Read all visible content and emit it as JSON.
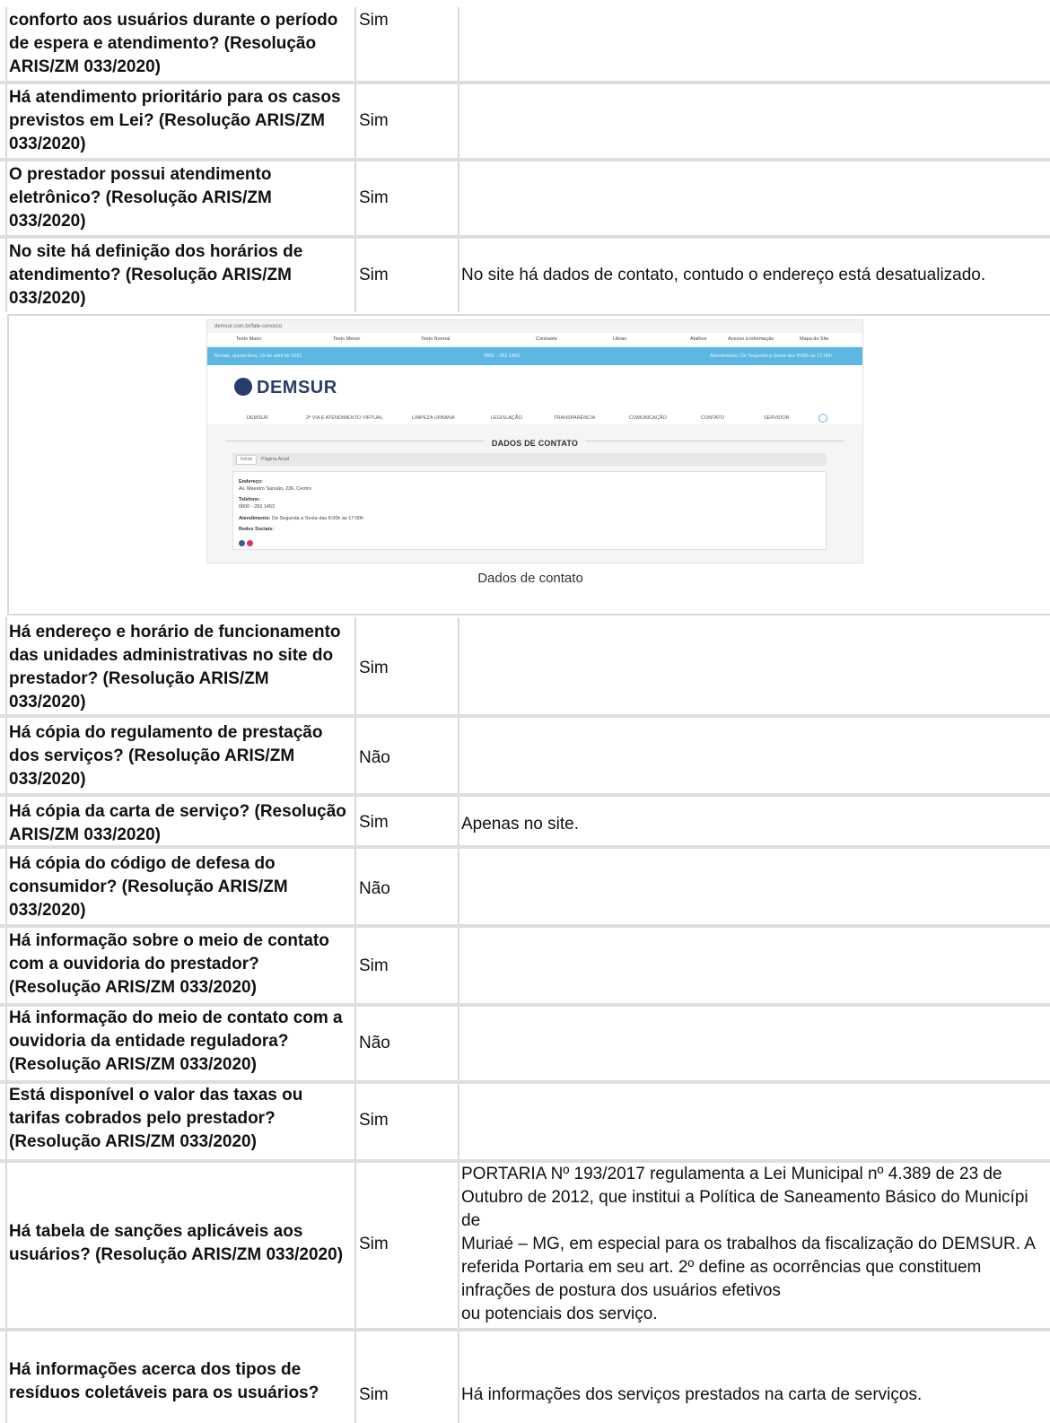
{
  "rows_top": [
    {
      "question": [
        "conforto aos usuários durante o período",
        "de espera e atendimento? (Resolução",
        "ARIS/ZM 033/2020)"
      ],
      "answer": "Sim",
      "comment": ""
    },
    {
      "question": [
        "Há atendimento prioritário para os casos",
        "previstos em Lei? (Resolução ARIS/ZM",
        "033/2020)"
      ],
      "answer": "Sim",
      "comment": ""
    },
    {
      "question": [
        "O prestador possui atendimento",
        "eletrônico? (Resolução ARIS/ZM",
        "033/2020)"
      ],
      "answer": "Sim",
      "comment": ""
    },
    {
      "question": [
        "No site há definição dos horários de",
        "atendimento? (Resolução ARIS/ZM",
        "033/2020)"
      ],
      "answer": "Sim",
      "comment": "No site há dados de contato, contudo o endereço está desatualizado."
    }
  ],
  "screenshot": {
    "url": "demsur.com.br/fale-conosco",
    "access_bar": [
      "Texto Maior",
      "Texto Menor",
      "Texto Normal",
      "Contraste",
      "Libras",
      "Atalhos",
      "Acesso à informação",
      "Mapa do Site"
    ],
    "blue_bar": {
      "date": "Muriaé, quinta-feira, 15 de abril de 2021",
      "phone": "0800 - 283 1453",
      "hours": "Atendimento: De Segunda a Sexta das 8:00h às 17:00h"
    },
    "logo": "DEMSUR",
    "nav": [
      "DEMSUR",
      "2ª VIA E ATENDIMENTO VIRTUAL",
      "LIMPEZA URBANA",
      "LEGISLAÇÃO",
      "TRANSPARÊNCIA",
      "COMUNICAÇÃO",
      "CONTATO",
      "SERVIDOR"
    ],
    "page_title": "DADOS DE CONTATO",
    "crumb_home": "Início",
    "crumb_current": "Página Atual",
    "card": {
      "address_label": "Endereço:",
      "address": "Av. Maestro Sansão, 236, Centro",
      "phone_label": "Telefone:",
      "phone": "0800 - 283 1453",
      "hours_label": "Atendimento:",
      "hours": "De Segunda a Sexta das 8:00h às 17:00h",
      "social_label": "Redes Sociais:"
    },
    "caption": "Dados de contato",
    "colors": {
      "blue_bar": "#5cb8e3",
      "logo": "#2a3c6b"
    }
  },
  "rows_bottom": [
    {
      "question": [
        "Há endereço e horário de funcionamento",
        "das unidades administrativas no site do",
        "prestador? (Resolução ARIS/ZM",
        "033/2020)"
      ],
      "answer": "Sim",
      "comment": ""
    },
    {
      "question": [
        "Há cópia do regulamento de prestação",
        "dos serviços? (Resolução ARIS/ZM",
        "033/2020)"
      ],
      "answer": "Não",
      "comment": ""
    },
    {
      "question": [
        "Há cópia da carta de serviço? (Resolução",
        "ARIS/ZM 033/2020)"
      ],
      "answer": "Sim",
      "comment": "Apenas no site."
    },
    {
      "question": [
        "Há cópia do código de defesa do",
        "consumidor? (Resolução ARIS/ZM",
        "033/2020)"
      ],
      "answer": "Não",
      "comment": ""
    },
    {
      "question": [
        "Há informação sobre o meio de contato",
        "com a ouvidoria do prestador?",
        "(Resolução ARIS/ZM 033/2020)"
      ],
      "answer": "Sim",
      "comment": ""
    },
    {
      "question": [
        "Há informação do meio de contato com a",
        "ouvidoria da entidade reguladora?",
        "(Resolução ARIS/ZM 033/2020)"
      ],
      "answer": "Não",
      "comment": ""
    },
    {
      "question": [
        "Está disponível o valor das taxas ou",
        "tarifas cobrados pelo prestador?",
        "(Resolução ARIS/ZM 033/2020)"
      ],
      "answer": "Sim",
      "comment": ""
    },
    {
      "question": [
        "Há tabela de sanções aplicáveis aos",
        "usuários? (Resolução ARIS/ZM 033/2020)"
      ],
      "answer": "Sim",
      "comment_lines": [
        "PORTARIA Nº 193/2017 regulamenta a Lei Municipal nº 4.389 de 23 de",
        "Outubro de 2012, que institui a Política de Saneamento Básico do Municípi",
        "de",
        "Muriaé – MG, em especial para os trabalhos da fiscalização do DEMSUR. A",
        "referida Portaria em seu art. 2º define as ocorrências que constituem",
        "infrações de postura dos usuários efetivos",
        "ou potenciais dos serviço."
      ]
    },
    {
      "question": [
        "Há informações acerca dos tipos de",
        "resíduos coletáveis para os usuários?"
      ],
      "answer": "Sim",
      "comment": "Há informações dos serviços prestados na carta de serviços."
    }
  ]
}
